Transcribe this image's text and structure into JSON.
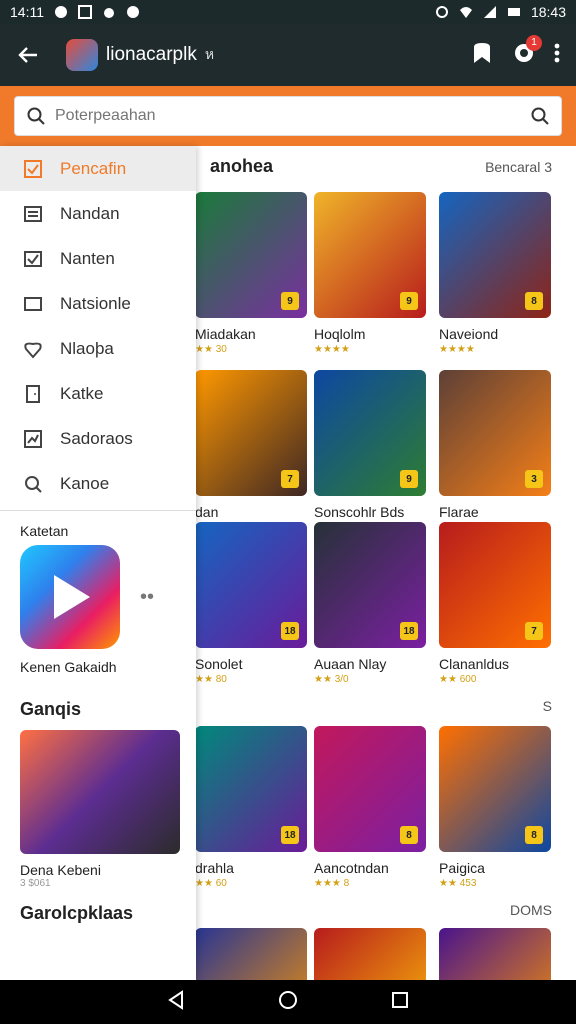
{
  "status": {
    "time": "14:11",
    "clock": "18:43"
  },
  "appbar": {
    "title": "lionacarplk",
    "sub": "ห"
  },
  "search": {
    "placeholder": "Poterpeaahan",
    "value": ""
  },
  "drawer": {
    "items": [
      {
        "label": "Pencafin",
        "icon": "checkbox-icon"
      },
      {
        "label": "Nandan",
        "icon": "list-icon"
      },
      {
        "label": "Nanten",
        "icon": "mail-check-icon"
      },
      {
        "label": "Natsionle",
        "icon": "tablet-icon"
      },
      {
        "label": "Nlaoþa",
        "icon": "heart-icon"
      },
      {
        "label": "Katke",
        "icon": "door-icon"
      },
      {
        "label": "Sadoraos",
        "icon": "chart-icon"
      },
      {
        "label": "Kanoe",
        "icon": "search-icon"
      }
    ],
    "section_label": "Katetan",
    "app_name": "Kenen Gakaidh",
    "games_heading": "Ganqis",
    "games_card_name": "Dena Kebeni",
    "games_card_rating": "3 $061",
    "bottom_heading": "Garolcpklaas"
  },
  "section": {
    "title": "anohea",
    "more": "Bencaral 3"
  },
  "rows": [
    {
      "cards": [
        {
          "name": "Miadakan",
          "rating": "★★ 30",
          "badge": "9",
          "colors": [
            "#1a7a3a",
            "#7a2fa0"
          ]
        },
        {
          "name": "Hoqlolm",
          "rating": "★★★★",
          "badge": "9",
          "colors": [
            "#f0b429",
            "#b71c1c"
          ]
        },
        {
          "name": "Naveiond",
          "rating": "★★★★",
          "badge": "8",
          "colors": [
            "#1565c0",
            "#8e2416"
          ]
        }
      ]
    },
    {
      "cards": [
        {
          "name": "dan",
          "rating": "",
          "badge": "7",
          "colors": [
            "#ff9800",
            "#3e2723"
          ]
        },
        {
          "name": "Sonscohlr Bds",
          "rating": "",
          "badge": "9",
          "colors": [
            "#0d47a1",
            "#2e7d32"
          ]
        },
        {
          "name": "Flarae",
          "rating": "",
          "badge": "3",
          "colors": [
            "#5d4037",
            "#f57f17"
          ]
        }
      ]
    },
    {
      "cards": [
        {
          "name": "Sonolet",
          "rating": "★★ 80",
          "badge": "18",
          "colors": [
            "#1565c0",
            "#6a1b9a"
          ]
        },
        {
          "name": "Auaan Nlay",
          "rating": "★★ 3/0",
          "badge": "18",
          "colors": [
            "#263238",
            "#7b1fa2"
          ]
        },
        {
          "name": "Clananldus",
          "rating": "★★ 600",
          "badge": "7",
          "colors": [
            "#b71c1c",
            "#ff6f00"
          ]
        }
      ]
    },
    {
      "cards": [
        {
          "name": "drahla",
          "rating": "★★ 60",
          "badge": "18",
          "colors": [
            "#00897b",
            "#6a1b9a"
          ]
        },
        {
          "name": "Aancotndan",
          "rating": "★★★ 8",
          "badge": "8",
          "colors": [
            "#c2185b",
            "#7b1fa2"
          ]
        },
        {
          "name": "Paigica",
          "rating": "★★ 453",
          "badge": "8",
          "colors": [
            "#ff6f00",
            "#0d47a1"
          ]
        }
      ]
    },
    {
      "cards": [
        {
          "name": "",
          "rating": "",
          "badge": "",
          "colors": [
            "#283593",
            "#ff9800"
          ]
        },
        {
          "name": "",
          "rating": "",
          "badge": "",
          "colors": [
            "#b71c1c",
            "#ffc107"
          ]
        },
        {
          "name": "",
          "rating": "",
          "badge": "",
          "colors": [
            "#4a148c",
            "#ff9800"
          ]
        }
      ]
    }
  ],
  "row3_more": "S",
  "row5_more": "DOMS"
}
